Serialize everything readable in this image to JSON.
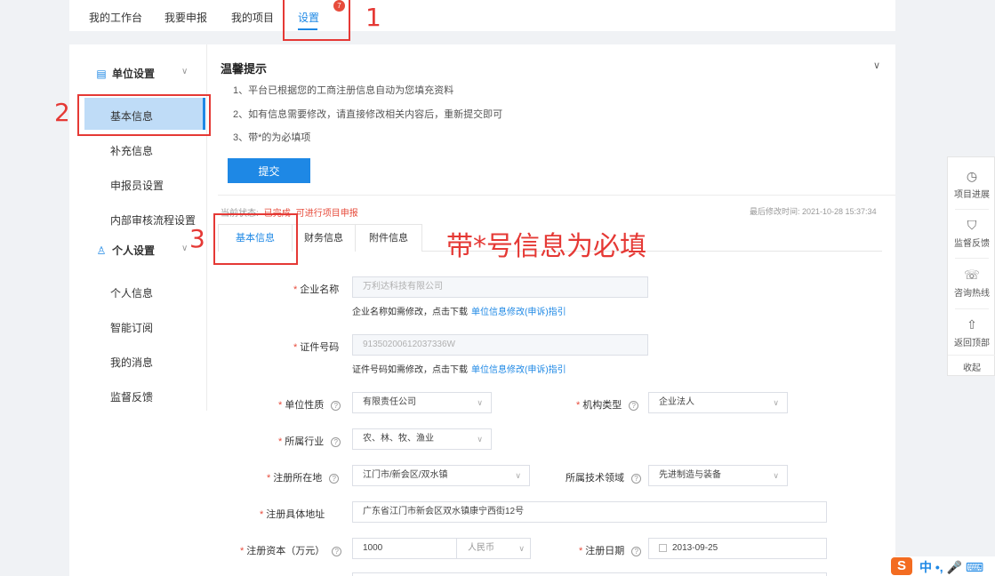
{
  "top_nav": {
    "items": [
      "我的工作台",
      "我要申报",
      "我的项目",
      "设置"
    ],
    "badge": "7"
  },
  "sidebar": {
    "group1": "单位设置",
    "group1_items": [
      "基本信息",
      "补充信息",
      "申报员设置",
      "内部审核流程设置"
    ],
    "group2": "个人设置",
    "group2_items": [
      "个人信息",
      "智能订阅",
      "我的消息",
      "监督反馈"
    ]
  },
  "tips": {
    "title": "温馨提示",
    "lines": [
      "1、平台已根据您的工商注册信息自动为您填充资料",
      "2、如有信息需要修改，请直接修改相关内容后，重新提交即可",
      "3、带*的为必填项"
    ],
    "submit_label": "提交"
  },
  "status": {
    "label": "当前状态:",
    "value": "已完成",
    "extra": "可进行项目申报",
    "last_modified": "最后修改时间: 2021-10-28 15:37:34"
  },
  "tabs": [
    "基本信息",
    "财务信息",
    "附件信息"
  ],
  "form": {
    "company_name": {
      "label": "企业名称",
      "value": "万利达科技有限公司",
      "hint": "企业名称如需修改，点击下载",
      "link": "单位信息修改(申诉)指引"
    },
    "cert_no": {
      "label": "证件号码",
      "value": "91350200612037336W",
      "hint": "证件号码如需修改，点击下载",
      "link": "单位信息修改(申诉)指引"
    },
    "unit_nature": {
      "label": "单位性质",
      "value": "有限责任公司"
    },
    "org_type": {
      "label": "机构类型",
      "value": "企业法人"
    },
    "industry": {
      "label": "所属行业",
      "value": "农、林、牧、渔业"
    },
    "location": {
      "label": "注册所在地",
      "value": "江门市/新会区/双水镇"
    },
    "tech_field": {
      "label": "所属技术领域",
      "value": "先进制造与装备"
    },
    "address": {
      "label": "注册具体地址",
      "value": "广东省江门市新会区双水镇康宁西街12号"
    },
    "capital": {
      "label": "注册资本（万元）",
      "value": "1000",
      "unit": "人民币"
    },
    "reg_date": {
      "label": "注册日期",
      "value": "2013-09-25"
    }
  },
  "annotations": {
    "n1": "1",
    "n2": "2",
    "n3": "3",
    "text": "带*号信息为必填"
  },
  "float_panel": {
    "items": [
      "项目进展",
      "监督反馈",
      "咨询热线",
      "返回顶部"
    ],
    "collapse": "收起"
  },
  "ime": {
    "logo": "S",
    "text": "中 •, 🎤 ⌨"
  },
  "colors": {
    "accent": "#1e88e5",
    "annotation": "#e53935",
    "active_bg": "#bfdcf7"
  }
}
